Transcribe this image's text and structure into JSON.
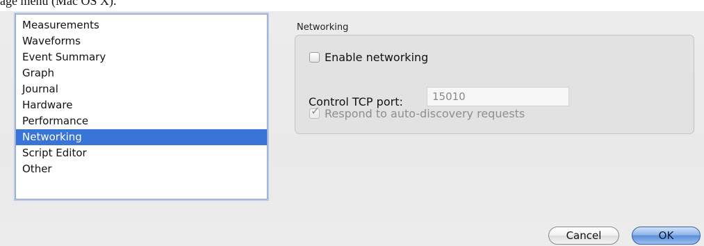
{
  "caption": {
    "text": "age menu (Mac OS X)."
  },
  "category_list": {
    "items": [
      {
        "label": "Measurements",
        "selected": false
      },
      {
        "label": "Waveforms",
        "selected": false
      },
      {
        "label": "Event Summary",
        "selected": false
      },
      {
        "label": "Graph",
        "selected": false
      },
      {
        "label": "Journal",
        "selected": false
      },
      {
        "label": "Hardware",
        "selected": false
      },
      {
        "label": "Performance",
        "selected": false
      },
      {
        "label": "Networking",
        "selected": true
      },
      {
        "label": "Script Editor",
        "selected": false
      },
      {
        "label": "Other",
        "selected": false
      }
    ],
    "selection_color": "#3875d7"
  },
  "networking": {
    "group_title": "Networking",
    "enable_label": "Enable networking",
    "enable_checked": false,
    "port_label": "Control TCP port:",
    "port_value": "15010",
    "discovery_label": "Respond to auto-discovery requests",
    "discovery_checked": true,
    "discovery_enabled": false
  },
  "buttons": {
    "cancel_label": "Cancel",
    "ok_label": "OK",
    "default_color": "#5c8fdb"
  }
}
